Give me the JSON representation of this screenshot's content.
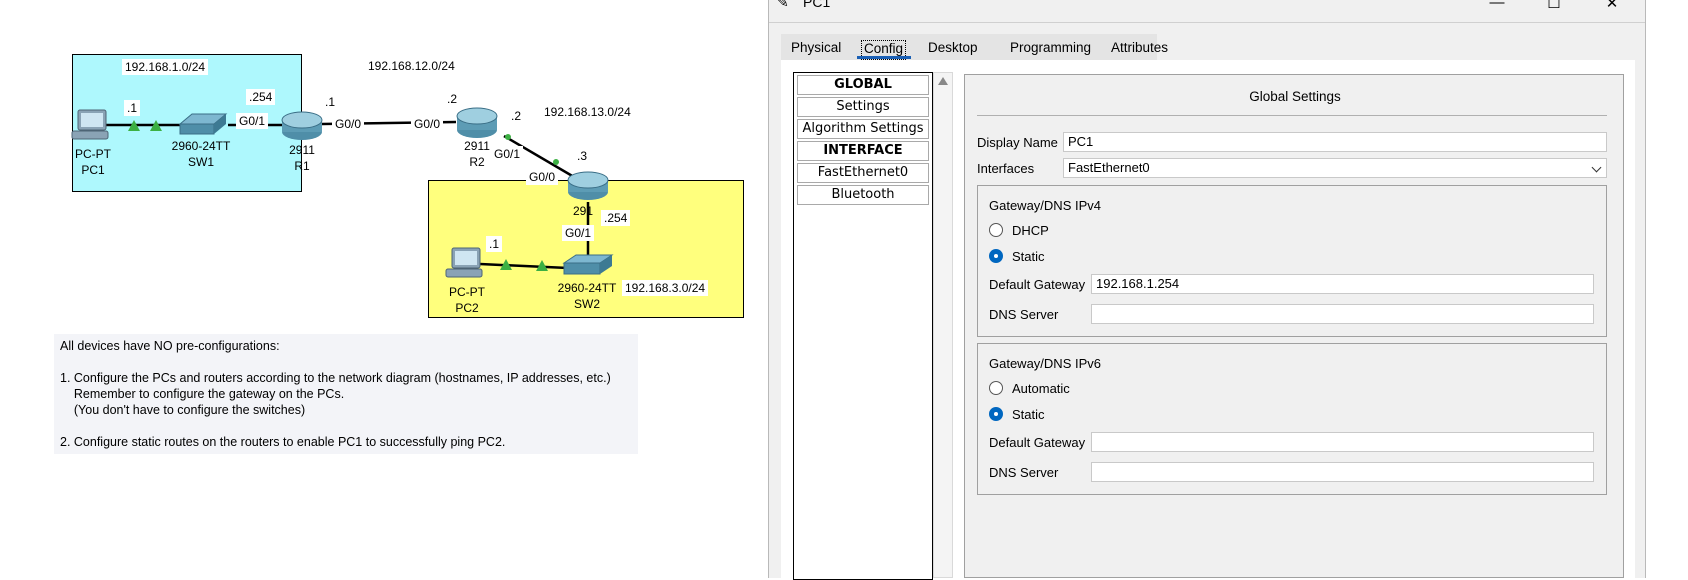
{
  "diagram": {
    "subnets": {
      "lan1": "192.168.1.0/24",
      "wan12": "192.168.12.0/24",
      "wan13": "192.168.13.0/24",
      "lan3": "192.168.3.0/24"
    },
    "devices": {
      "pc1": {
        "model": "PC-PT",
        "name": "PC1"
      },
      "sw1": {
        "model": "2960-24TT",
        "name": "SW1"
      },
      "r1": {
        "model": "2911",
        "name": "R1"
      },
      "r2": {
        "model": "2911",
        "name": "R2"
      },
      "r3": {
        "model": "291",
        "name": ""
      },
      "pc2": {
        "model": "PC-PT",
        "name": "PC2"
      },
      "sw2": {
        "model": "2960-24TT",
        "name": "SW2"
      }
    },
    "labels": {
      "pc1_host": ".1",
      "r1_g01_host": ".254",
      "r1_g01": "G0/1",
      "r1_g00_host": ".1",
      "r1_g00": "G0/0",
      "r2_g00": "G0/0",
      "r2_g00_host": ".2",
      "r2_g01_host": ".2",
      "r2_g01": "G0/1",
      "r3_g00_host": ".3",
      "r3_g00": "G0/0",
      "r3_g01_host": ".254",
      "r3_g01": "G0/1",
      "pc2_host": ".1"
    },
    "colors": {
      "lan1_zone": "#aef8fd",
      "lan3_zone": "#ffff7d",
      "link_up": "#3cb043"
    }
  },
  "instructions": {
    "line1": "All devices have NO pre-configurations:",
    "line2": "1. Configure the PCs and routers according to the network diagram (hostnames, IP addresses, etc.)",
    "line3": "    Remember to configure the gateway on the PCs.",
    "line4": "    (You don't have to configure the switches)",
    "line5": "2. Configure static routes on the routers to enable PC1 to successfully ping PC2."
  },
  "window": {
    "title": "PC1",
    "controls": {
      "minimize": "—",
      "maximize": "☐",
      "close": "✕"
    },
    "tabs": [
      "Physical",
      "Config",
      "Desktop",
      "Programming",
      "Attributes"
    ],
    "active_tab": "Config",
    "sidebar": {
      "items": [
        "GLOBAL",
        "Settings",
        "Algorithm Settings",
        "INTERFACE",
        "FastEthernet0",
        "Bluetooth"
      ]
    },
    "global_settings": {
      "title": "Global Settings",
      "display_name_label": "Display Name",
      "display_name_value": "PC1",
      "interfaces_label": "Interfaces",
      "interfaces_value": "FastEthernet0",
      "ipv4": {
        "group_title": "Gateway/DNS IPv4",
        "option_dhcp": "DHCP",
        "option_static": "Static",
        "selected": "Static",
        "gateway_label": "Default Gateway",
        "gateway_value": "192.168.1.254",
        "dns_label": "DNS Server",
        "dns_value": ""
      },
      "ipv6": {
        "group_title": "Gateway/DNS IPv6",
        "option_auto": "Automatic",
        "option_static": "Static",
        "selected": "Static",
        "gateway_label": "Default Gateway",
        "gateway_value": "",
        "dns_label": "DNS Server",
        "dns_value": ""
      }
    }
  }
}
